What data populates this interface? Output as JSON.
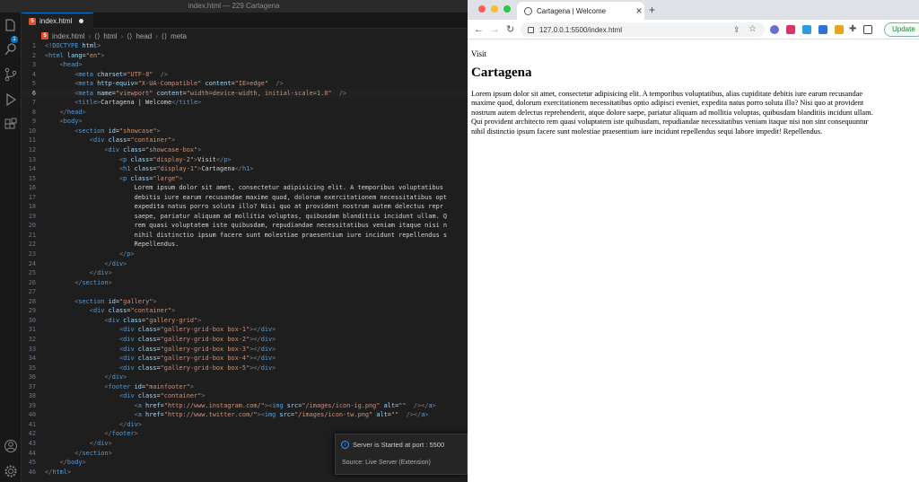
{
  "vscode": {
    "window_title": "index.html — 229 Cartagena",
    "activity": {
      "badge": "1"
    },
    "tab": {
      "label": "index.html"
    },
    "breadcrumb": [
      "index.html",
      "html",
      "head",
      "meta"
    ],
    "toast": {
      "message": "Server is Started at port : 5500",
      "source": "Source: Live Server (Extension)"
    },
    "cursor_line": 6
  },
  "code_lines": [
    "<!DOCTYPE html>",
    "<html lang=\"en\">",
    "    <head>",
    "        <meta charset=\"UTF-8\" />",
    "        <meta http-equiv=\"X-UA-Compatible\" content=\"IE=edge\" />",
    "        <meta name=\"viewport\" content=\"width=device-width, initial-scale=1.0\" />",
    "        <title>Cartagena | Welcome</title>",
    "    </head>",
    "    <body>",
    "        <section id=\"showcase\">",
    "            <div class=\"container\">",
    "                <div class=\"showcase-box\">",
    "                    <p class=\"display-2\">Visit</p>",
    "                    <h1 class=\"display-1\">Cartagena</h1>",
    "                    <p class=\"large\">",
    "                        Lorem ipsum dolor sit amet, consectetur adipisicing elit. A temporibus voluptatibus",
    "                        debitis iure earum recusandae maxime quod, dolorum exercitationem necessitatibus opt",
    "                        expedita natus porro soluta illo? Nisi quo at provident nostrum autem delectus repr",
    "                        saepe, pariatur aliquam ad mollitia voluptas, quibusdam blanditiis incidunt ullam. Q",
    "                        rem quasi voluptatem iste quibusdam, repudiandae necessitatibus veniam itaque nisi n",
    "                        nihil distinctio ipsum facere sunt molestiae praesentium iure incidunt repellendus s",
    "                        Repellendus.",
    "                    </p>",
    "                </div>",
    "            </div>",
    "        </section>",
    "",
    "        <section id=\"gallery\">",
    "            <div class=\"container\">",
    "                <div class=\"gallery-grid\">",
    "                    <div class=\"gallery-grid-box box-1\"></div>",
    "                    <div class=\"gallery-grid-box box-2\"></div>",
    "                    <div class=\"gallery-grid-box box-3\"></div>",
    "                    <div class=\"gallery-grid-box box-4\"></div>",
    "                    <div class=\"gallery-grid-box box-5\"></div>",
    "                </div>",
    "                <footer id=\"mainfooter\">",
    "                    <div class=\"container\">",
    "                        <a href=\"http://www.instagram.com/\"><img src=\"/images/icon-ig.png\" alt=\"\" /></a>",
    "                        <a href=\"http://www.twitter.com/\"><img src=\"/images/icon-tw.png\" alt=\"\" /></a>",
    "                    </div>",
    "                </footer>",
    "            </div>",
    "        </section>",
    "    </body>",
    "</html>"
  ],
  "browser": {
    "tab_title": "Cartagena | Welcome",
    "url": "127.0.0.1:5500/index.html",
    "update_label": "Update",
    "page": {
      "visit": "Visit",
      "heading": "Cartagena",
      "paragraph_lines": [
        "Lorem ipsum dolor sit amet, consectetur adipisicing elit. A temporibus voluptatibus, alias cupiditate debitis iure earum recusandae",
        "maxime quod, dolorum exercitationem necessitatibus optio adipisci eveniet, expedita natus porro soluta illo? Nisi quo at provident",
        "nostrum autem delectus reprehenderit, atque dolore saepe, pariatur aliquam ad mollitia voluptas, quibusdam blanditiis incidunt ullam.",
        "Qui provident architecto rem quasi voluptatem iste quibusdam, repudiandae necessitatibus veniam itaque nisi non sint consequuntur",
        "nihil distinctio ipsum facere sunt molestiae praesentium iure incidunt repellendus sequi labore impedit! Repellendus."
      ]
    }
  },
  "colors": {
    "accent": "#0078d4",
    "tag": "#569cd6",
    "attr": "#9cdcfe",
    "string": "#ce9178",
    "update": "#1a7f37"
  }
}
